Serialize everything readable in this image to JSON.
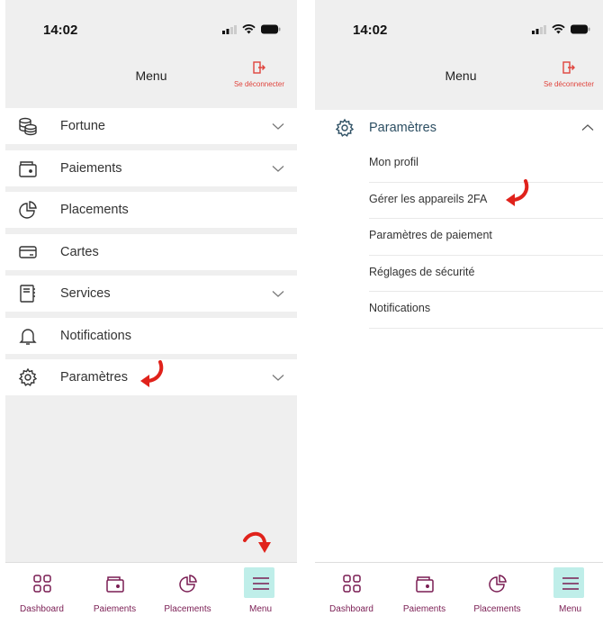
{
  "status": {
    "time": "14:02"
  },
  "header": {
    "title": "Menu",
    "logout_label": "Se déconnecter"
  },
  "left_menu": {
    "items": [
      {
        "label": "Fortune",
        "icon": "coins-icon",
        "has_chevron": true
      },
      {
        "label": "Paiements",
        "icon": "wallet-icon",
        "has_chevron": true
      },
      {
        "label": "Placements",
        "icon": "pie-chart-icon",
        "has_chevron": false
      },
      {
        "label": "Cartes",
        "icon": "card-icon",
        "has_chevron": false
      },
      {
        "label": "Services",
        "icon": "notebook-icon",
        "has_chevron": true
      },
      {
        "label": "Notifications",
        "icon": "bell-icon",
        "has_chevron": false
      },
      {
        "label": "Paramètres",
        "icon": "gear-icon",
        "has_chevron": true
      }
    ]
  },
  "right_menu": {
    "section": {
      "label": "Paramètres",
      "icon": "gear-icon",
      "expanded": true
    },
    "subitems": [
      {
        "label": "Mon profil"
      },
      {
        "label": "Gérer les appareils 2FA"
      },
      {
        "label": "Paramètres de paiement"
      },
      {
        "label": "Réglages de sécurité"
      },
      {
        "label": "Notifications"
      }
    ]
  },
  "tabbar": {
    "tabs": [
      {
        "label": "Dashboard",
        "icon": "dashboard-icon"
      },
      {
        "label": "Paiements",
        "icon": "wallet-icon"
      },
      {
        "label": "Placements",
        "icon": "pie-chart-icon"
      },
      {
        "label": "Menu",
        "icon": "hamburger-icon",
        "active": true
      }
    ]
  },
  "colors": {
    "accent": "#7a1d53",
    "logout": "#e0443d",
    "active_tab_bg": "#bfeee9",
    "annotation_arrow": "#e0221b",
    "section_text": "#2d4f63"
  }
}
